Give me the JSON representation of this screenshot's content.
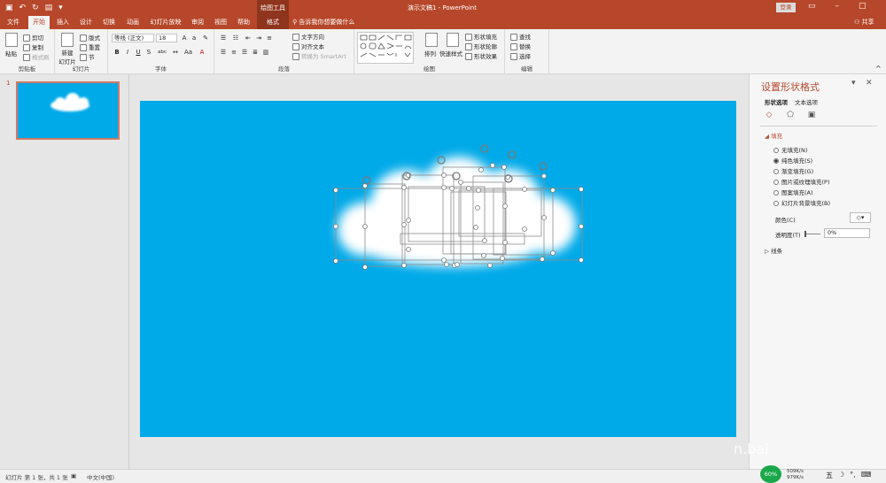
{
  "app": {
    "title": "演示文稿1  -  PowerPoint",
    "context_label": "绘图工具",
    "login": "登录",
    "share": "共享",
    "tell_me": "告诉我你想要做什么"
  },
  "tabs": [
    "文件",
    "开始",
    "插入",
    "设计",
    "切换",
    "动画",
    "幻灯片放映",
    "审阅",
    "视图",
    "帮助",
    "格式"
  ],
  "ribbon": {
    "clipboard": {
      "paste": "粘贴",
      "cut": "剪切",
      "copy": "复制",
      "format_painter": "格式刷",
      "label": "剪贴板"
    },
    "slides": {
      "new_slide": "新建\n幻灯片",
      "layout": "版式",
      "reset": "重置",
      "section": "节",
      "label": "幻灯片"
    },
    "font": {
      "font_name": "等线 (正文)",
      "font_size": "18",
      "label": "字体",
      "bold": "B",
      "italic": "I",
      "underline": "U",
      "strike": "S",
      "shadow": "abc"
    },
    "paragraph": {
      "text_direction": "文字方向",
      "align_text": "对齐文本",
      "smartart": "转换为 SmartArt",
      "label": "段落"
    },
    "drawing": {
      "arrange": "排列",
      "quick_styles": "快速样式",
      "shape_fill": "形状填充",
      "shape_outline": "形状轮廓",
      "shape_effects": "形状效果",
      "label": "绘图"
    },
    "editing": {
      "find": "查找",
      "replace": "替换",
      "select": "选择",
      "label": "编辑"
    }
  },
  "thumbnails": {
    "slide_number": "1"
  },
  "format_pane": {
    "title": "设置形状格式",
    "tab_shape_options": "形状选项",
    "tab_text_options": "文本选项",
    "fill_section": "填充",
    "fill_options": [
      {
        "label": "无填充(N)",
        "checked": false
      },
      {
        "label": "纯色填充(S)",
        "checked": true
      },
      {
        "label": "渐变填充(G)",
        "checked": false
      },
      {
        "label": "图片或纹理填充(P)",
        "checked": false
      },
      {
        "label": "图案填充(A)",
        "checked": false
      },
      {
        "label": "幻灯片背景填充(B)",
        "checked": false
      }
    ],
    "color_label": "颜色(C)",
    "transparency_label": "透明度(T)",
    "transparency_value": "0%",
    "line_section": "线条"
  },
  "status": {
    "slide_info": "幻灯片 第 1 张，共 1 张",
    "language": "中文(中国)",
    "cpu_badge": "60%",
    "net_up": "509K/s",
    "net_down": "979K/s",
    "ime": "五"
  },
  "watermark": "n.bai",
  "colors": {
    "accent": "#b7472a",
    "slide_bg": "#00a9e8",
    "cloud": "#ffffff"
  }
}
